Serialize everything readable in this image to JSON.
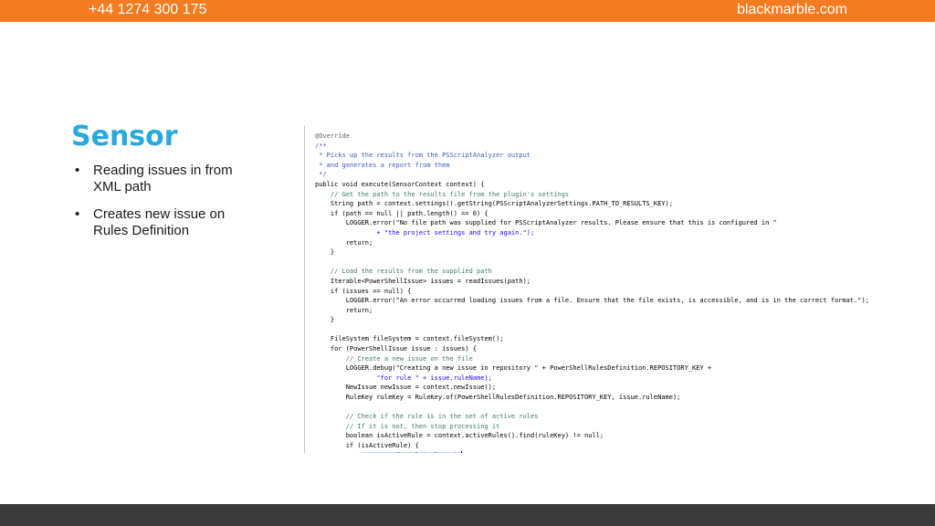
{
  "header": {
    "phone": "+44 1274 300 175",
    "website": "blackmarble.com",
    "bar_color": "#f47b20"
  },
  "slide": {
    "title": "Sensor",
    "title_color": "#29a8dc",
    "bullets": [
      "Reading issues in from XML path",
      "Creates new issue on Rules Definition"
    ]
  },
  "code": {
    "lines": [
      {
        "kind": "annot",
        "text": "@Override"
      },
      {
        "kind": "doc",
        "text": "/**"
      },
      {
        "kind": "doc",
        "text": " * Picks up the results from the PSScriptAnalyzer output"
      },
      {
        "kind": "doc",
        "text": " * and generates a report from them"
      },
      {
        "kind": "doc",
        "text": " */"
      },
      {
        "kind": "plain",
        "text": "public void execute(SensorContext context) {"
      },
      {
        "kind": "comment",
        "text": "    // Get the path to the results file from the plugin's settings"
      },
      {
        "kind": "plain",
        "text": "    String path = context.settings().getString(PSScriptAnalyzerSettings.PATH_TO_RESULTS_KEY);"
      },
      {
        "kind": "plain",
        "text": "    if (path == null || path.length() == 0) {"
      },
      {
        "kind": "plain",
        "text": "        LOGGER.error(\"No file path was supplied for PSScriptAnalyzer results. Please ensure that this is configured in \""
      },
      {
        "kind": "str",
        "text": "                + \"the project settings and try again.\");"
      },
      {
        "kind": "plain",
        "text": "        return;"
      },
      {
        "kind": "plain",
        "text": "    }"
      },
      {
        "kind": "plain",
        "text": ""
      },
      {
        "kind": "comment",
        "text": "    // Load the results from the supplied path"
      },
      {
        "kind": "plain",
        "text": "    Iterable<PowerShellIssue> issues = readIssues(path);"
      },
      {
        "kind": "plain",
        "text": "    if (issues == null) {"
      },
      {
        "kind": "plain",
        "text": "        LOGGER.error(\"An error occurred loading issues from a file. Ensure that the file exists, is accessible, and is in the correct format.\");"
      },
      {
        "kind": "plain",
        "text": "        return;"
      },
      {
        "kind": "plain",
        "text": "    }"
      },
      {
        "kind": "plain",
        "text": ""
      },
      {
        "kind": "plain",
        "text": "    FileSystem fileSystem = context.fileSystem();"
      },
      {
        "kind": "plain",
        "text": "    for (PowerShellIssue issue : issues) {"
      },
      {
        "kind": "comment",
        "text": "        // Create a new issue on the file"
      },
      {
        "kind": "plain",
        "text": "        LOGGER.debug(\"Creating a new issue in repository \" + PowerShellRulesDefinition.REPOSITORY_KEY +"
      },
      {
        "kind": "str",
        "text": "                \"for rule \" + issue.ruleName);"
      },
      {
        "kind": "plain",
        "text": "        NewIssue newIssue = context.newIssue();"
      },
      {
        "kind": "plain",
        "text": "        RuleKey ruleKey = RuleKey.of(PowerShellRulesDefinition.REPOSITORY_KEY, issue.ruleName);"
      },
      {
        "kind": "plain",
        "text": ""
      },
      {
        "kind": "comment",
        "text": "        // Check if the rule is in the set of active rules"
      },
      {
        "kind": "comment",
        "text": "        // If it is not, then stop processing it"
      },
      {
        "kind": "plain",
        "text": "        boolean isActiveRule = context.activeRules().find(ruleKey) != null;"
      },
      {
        "kind": "plain",
        "text": "        if (isActiveRule) {"
      },
      {
        "kind": "sel",
        "text": "            newIssue.forRule(ruleKey);"
      },
      {
        "kind": "plain",
        "text": "            ..."
      }
    ]
  }
}
